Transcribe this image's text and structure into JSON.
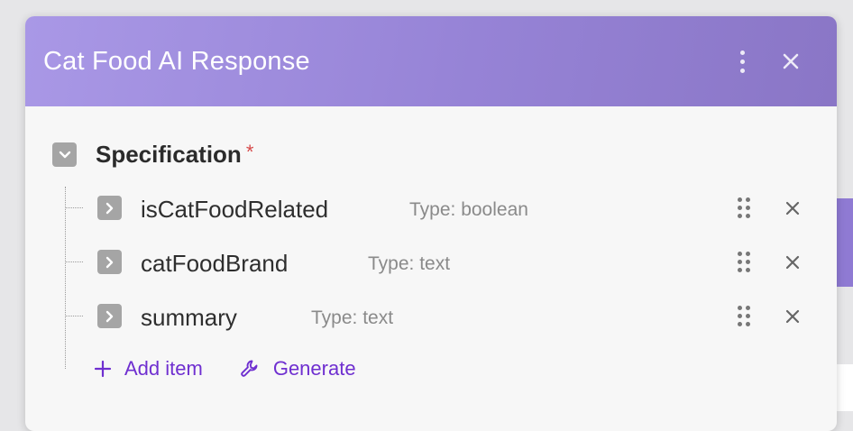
{
  "dialog": {
    "title": "Cat Food AI Response",
    "menu_icon": "kebab-icon",
    "close_icon": "close-icon"
  },
  "specification": {
    "label": "Specification",
    "required_marker": "*",
    "expanded": true,
    "items": [
      {
        "name": "isCatFoodRelated",
        "type": "Type: boolean"
      },
      {
        "name": "catFoodBrand",
        "type": "Type: text"
      },
      {
        "name": "summary",
        "type": "Type: text"
      }
    ]
  },
  "actions": {
    "add_item": "Add item",
    "generate": "Generate"
  },
  "colors": {
    "header_start": "#a998e6",
    "header_end": "#8a76c6",
    "accent": "#6f2fd0",
    "required": "#d64a4a"
  }
}
